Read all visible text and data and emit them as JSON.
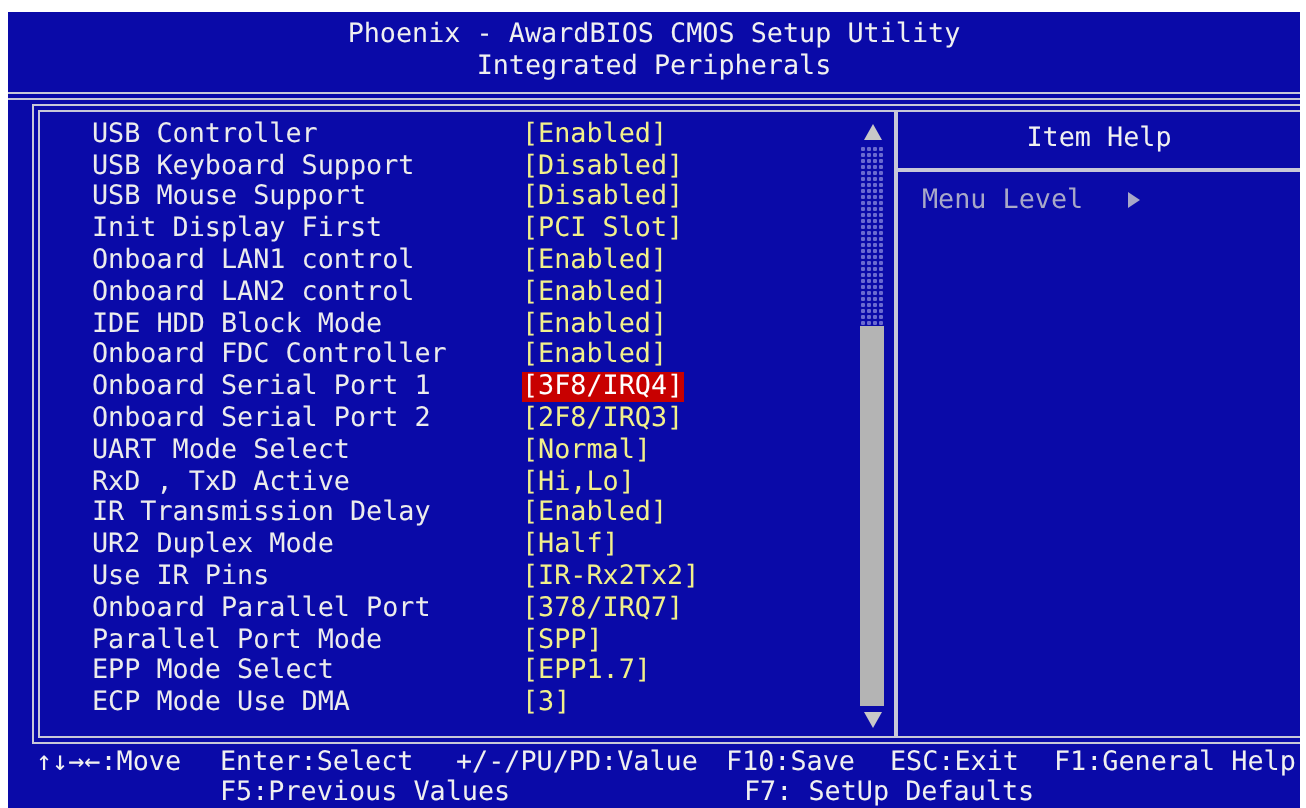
{
  "header": {
    "title": "Phoenix - AwardBIOS CMOS Setup Utility",
    "subtitle": "Integrated Peripherals"
  },
  "items": [
    {
      "label": "USB Controller",
      "value": "[Enabled]",
      "selected": false
    },
    {
      "label": "USB Keyboard Support",
      "value": "[Disabled]",
      "selected": false
    },
    {
      "label": "USB Mouse Support",
      "value": "[Disabled]",
      "selected": false
    },
    {
      "label": "Init Display First",
      "value": "[PCI Slot]",
      "selected": false
    },
    {
      "label": "Onboard LAN1 control",
      "value": "[Enabled]",
      "selected": false
    },
    {
      "label": "Onboard LAN2 control",
      "value": "[Enabled]",
      "selected": false
    },
    {
      "label": "IDE HDD Block Mode",
      "value": "[Enabled]",
      "selected": false
    },
    {
      "label": "Onboard FDC Controller",
      "value": "[Enabled]",
      "selected": false
    },
    {
      "label": "Onboard Serial Port 1",
      "value": "[3F8/IRQ4]",
      "selected": true
    },
    {
      "label": "Onboard Serial Port 2",
      "value": "[2F8/IRQ3]",
      "selected": false
    },
    {
      "label": "UART Mode Select",
      "value": "[Normal]",
      "selected": false
    },
    {
      "label": "RxD , TxD Active",
      "value": "[Hi,Lo]",
      "selected": false
    },
    {
      "label": "IR Transmission Delay",
      "value": "[Enabled]",
      "selected": false
    },
    {
      "label": "UR2 Duplex Mode",
      "value": "[Half]",
      "selected": false
    },
    {
      "label": "Use IR Pins",
      "value": "[IR-Rx2Tx2]",
      "selected": false
    },
    {
      "label": "Onboard Parallel Port",
      "value": "[378/IRQ7]",
      "selected": false
    },
    {
      "label": "Parallel Port Mode",
      "value": "[SPP]",
      "selected": false
    },
    {
      "label": "EPP Mode Select",
      "value": "[EPP1.7]",
      "selected": false
    },
    {
      "label": "ECP Mode Use DMA",
      "value": "[3]",
      "selected": false
    }
  ],
  "help": {
    "title": "Item Help",
    "menu_level": "Menu Level"
  },
  "footer": {
    "line1": [
      "↑↓→←:Move",
      "Enter:Select",
      "+/-/PU/PD:Value",
      "F10:Save",
      "ESC:Exit",
      "F1:General Help"
    ],
    "line2": [
      "F5:Previous Values",
      "F7: SetUp Defaults"
    ]
  }
}
